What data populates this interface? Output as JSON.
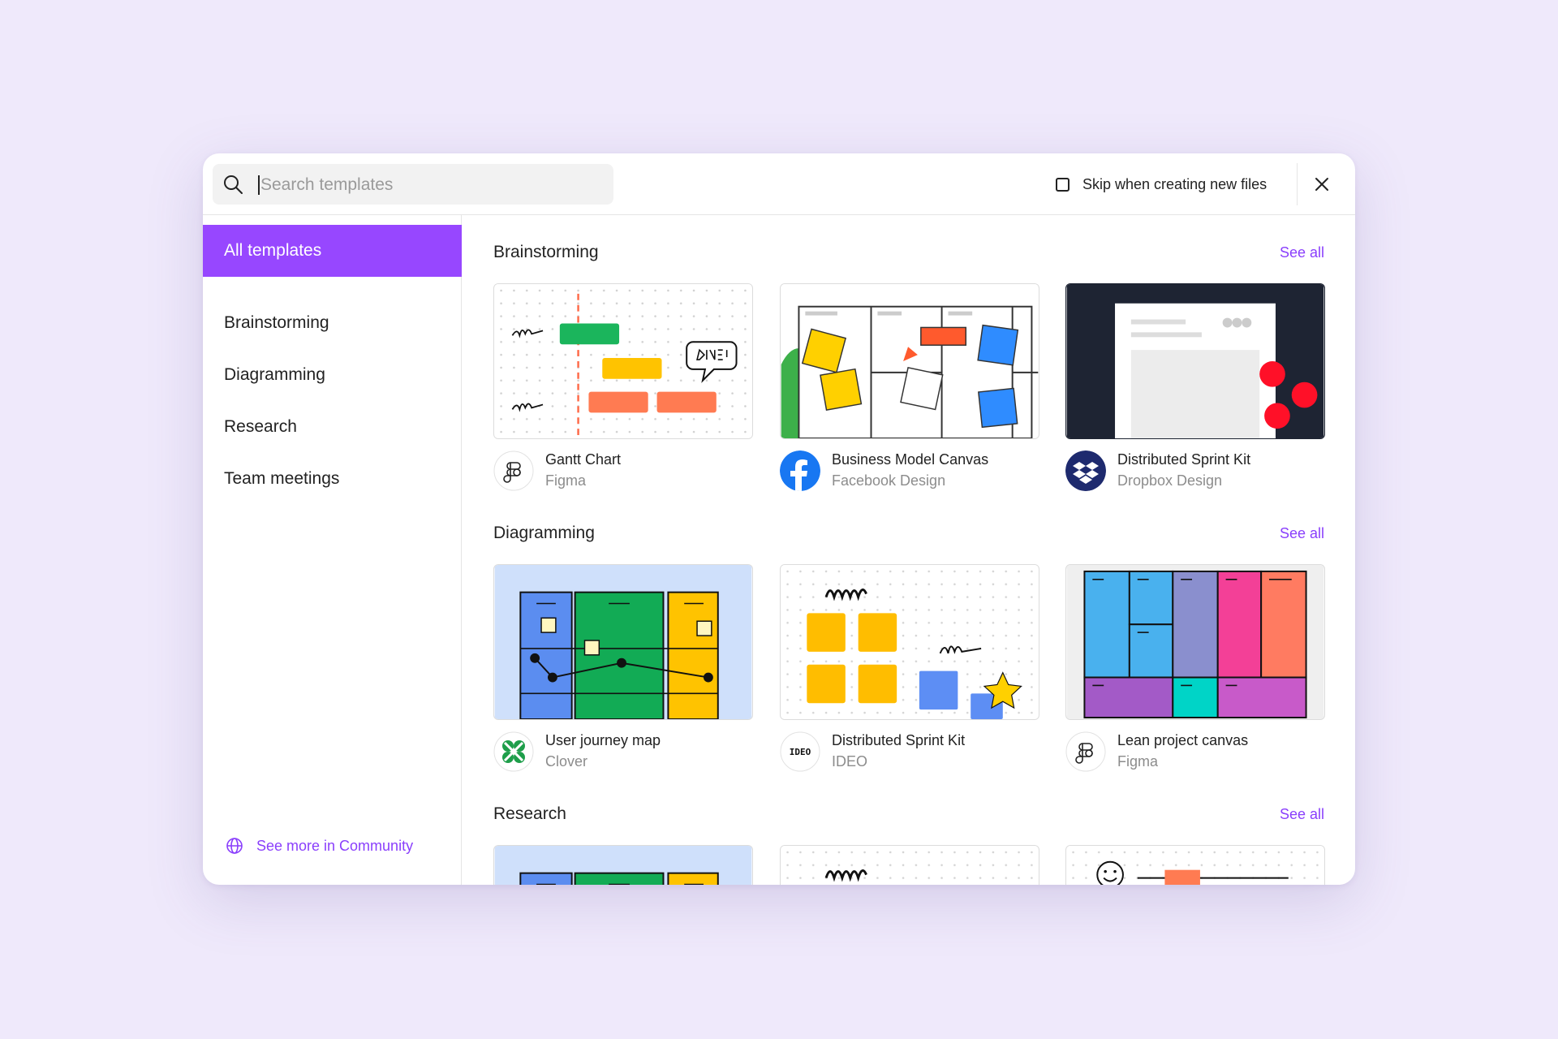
{
  "search": {
    "placeholder": "Search templates"
  },
  "skip_label": "Skip when creating new files",
  "sidebar": {
    "items": [
      {
        "label": "All templates",
        "active": true
      },
      {
        "label": "Brainstorming"
      },
      {
        "label": "Diagramming"
      },
      {
        "label": "Research"
      },
      {
        "label": "Team meetings"
      }
    ],
    "community_label": "See more in Community"
  },
  "sections": [
    {
      "title": "Brainstorming",
      "see_all": "See all",
      "cards": [
        {
          "name": "Gantt Chart",
          "author": "Figma",
          "icon": "figma-logo-icon"
        },
        {
          "name": "Business Model Canvas",
          "author": "Facebook Design",
          "icon": "facebook-logo-icon"
        },
        {
          "name": "Distributed Sprint Kit",
          "author": "Dropbox Design",
          "icon": "dropbox-logo-icon"
        }
      ]
    },
    {
      "title": "Diagramming",
      "see_all": "See all",
      "cards": [
        {
          "name": "User journey map",
          "author": "Clover",
          "icon": "clover-logo-icon"
        },
        {
          "name": "Distributed Sprint Kit",
          "author": "IDEO",
          "icon": "ideo-logo-icon",
          "logo_text": "IDEO"
        },
        {
          "name": "Lean project canvas",
          "author": "Figma",
          "icon": "figma-logo-icon"
        }
      ]
    },
    {
      "title": "Research",
      "see_all": "See all",
      "cards": []
    }
  ],
  "colors": {
    "accent": "#9747ff",
    "link": "#8a3ffc",
    "background": "#efe9fb"
  }
}
